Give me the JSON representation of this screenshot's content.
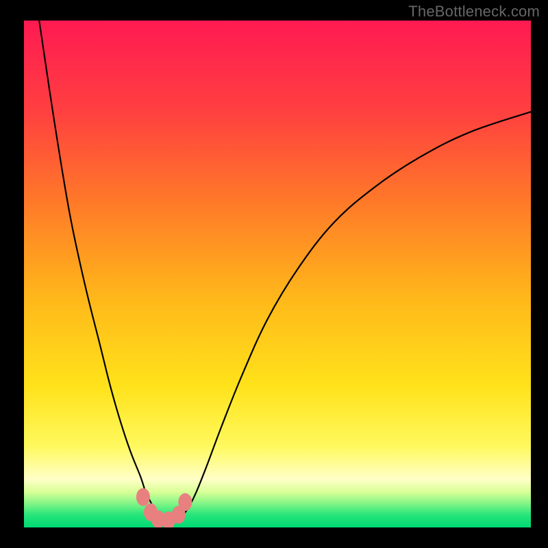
{
  "watermark": "TheBottleneck.com",
  "chart_data": {
    "type": "line",
    "title": "",
    "xlabel": "",
    "ylabel": "",
    "xlim": [
      0,
      100
    ],
    "ylim": [
      0,
      100
    ],
    "background_gradient": {
      "stops": [
        {
          "pos": 0.0,
          "color": "#ff1a52"
        },
        {
          "pos": 0.18,
          "color": "#ff4040"
        },
        {
          "pos": 0.36,
          "color": "#ff7a28"
        },
        {
          "pos": 0.55,
          "color": "#ffb81a"
        },
        {
          "pos": 0.72,
          "color": "#ffe21a"
        },
        {
          "pos": 0.84,
          "color": "#fff95e"
        },
        {
          "pos": 0.905,
          "color": "#ffffc8"
        },
        {
          "pos": 0.93,
          "color": "#d8ff96"
        },
        {
          "pos": 0.95,
          "color": "#8ef788"
        },
        {
          "pos": 0.975,
          "color": "#27e57b"
        },
        {
          "pos": 1.0,
          "color": "#00d973"
        }
      ]
    },
    "series": [
      {
        "name": "left-curve",
        "x": [
          3,
          6,
          9,
          12,
          15,
          17,
          19,
          21,
          23,
          24,
          25,
          25.8,
          26.5,
          27.2,
          28
        ],
        "y": [
          100,
          80,
          62,
          48,
          36,
          28,
          21,
          15,
          10,
          7,
          5,
          3.5,
          2.5,
          1.8,
          1.2
        ]
      },
      {
        "name": "right-curve",
        "x": [
          30,
          31,
          32.5,
          34,
          36,
          39,
          43,
          48,
          54,
          61,
          69,
          78,
          88,
          100
        ],
        "y": [
          1.2,
          2,
          4,
          7,
          12,
          20,
          30,
          41,
          51,
          60,
          67,
          73,
          78,
          82
        ]
      }
    ],
    "markers": {
      "name": "bottom-dots",
      "color": "#e88080",
      "points": [
        {
          "x": 23.5,
          "y": 6
        },
        {
          "x": 25,
          "y": 3
        },
        {
          "x": 26.5,
          "y": 1.6
        },
        {
          "x": 28.5,
          "y": 1.4
        },
        {
          "x": 30.5,
          "y": 2.5
        },
        {
          "x": 31.8,
          "y": 5
        }
      ]
    }
  }
}
